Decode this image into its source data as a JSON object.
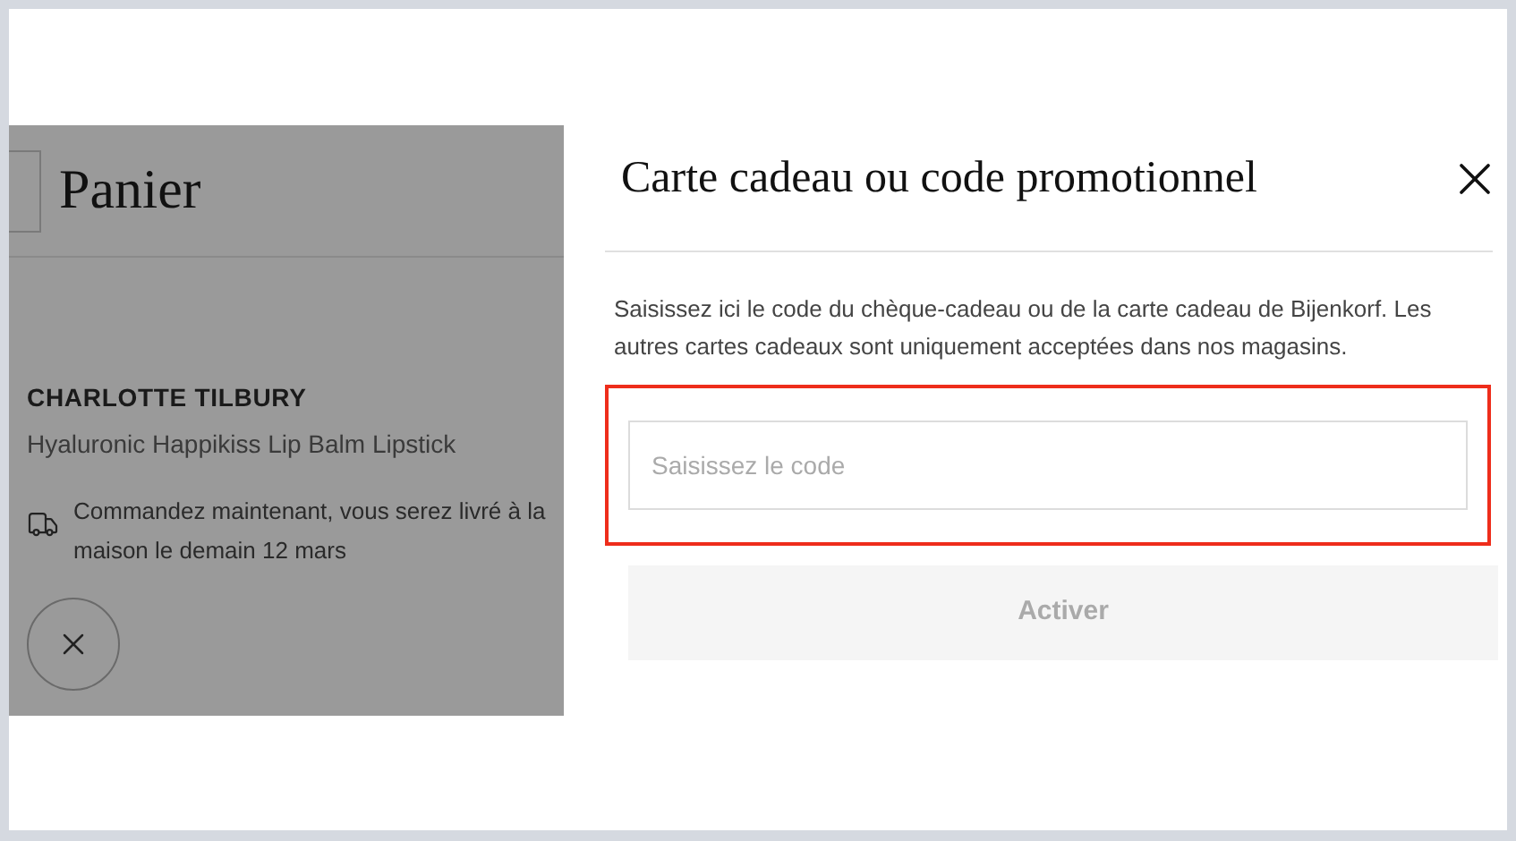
{
  "cart": {
    "title": "Panier",
    "brand": "CHARLOTTE TILBURY",
    "product": "Hyaluronic Happikiss Lip Balm Lipstick",
    "delivery_lines": [
      "Commandez maintenant, vous serez livré à la",
      "maison le demain 12 mars"
    ]
  },
  "dialog": {
    "title": "Carte cadeau ou code promotionnel",
    "description": "Saisissez ici le code du chèque-cadeau ou de la carte cadeau de Bijenkorf. Les autres cartes cadeaux sont uniquement acceptées dans nos magasins.",
    "field": {
      "placeholder": "Saisissez le code",
      "highlighted": true
    },
    "button": {
      "label": "Activer",
      "disabled": true
    }
  }
}
